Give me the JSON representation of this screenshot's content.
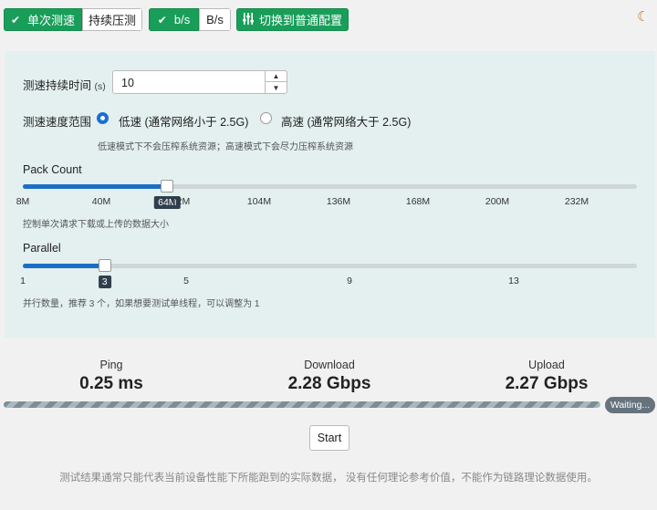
{
  "toolbar": {
    "mode_single": "单次测速",
    "mode_continuous": "持续压测",
    "unit_bits": "b/s",
    "unit_bytes": "B/s",
    "switch_label": "切换到普通配置"
  },
  "settings": {
    "duration_label": "测速持续时间",
    "duration_unit": "(s)",
    "duration_value": "10",
    "range_label": "测速速度范围",
    "low_speed": "低速 (通常网络小于 2.5G)",
    "high_speed": "高速 (通常网络大于 2.5G)",
    "range_note": "低速模式下不会压榨系统资源；高速模式下会尽力压榨系统资源",
    "pack_count_label": "Pack Count",
    "pack_count_value_label": "64M",
    "pack_count_fraction": 0.2353,
    "pack_count_ticks": [
      "8M",
      "40M",
      "72M",
      "104M",
      "136M",
      "168M",
      "200M",
      "232M"
    ],
    "pack_count_note": "控制单次请求下载或上传的数据大小",
    "parallel_label": "Parallel",
    "parallel_value_label": "3",
    "parallel_fraction": 0.1333,
    "parallel_ticks": [
      "1",
      "5",
      "9",
      "13"
    ],
    "parallel_note": "并行数量，推荐 3 个，如果想要测试单线程，可以调整为 1"
  },
  "stats": {
    "ping_label": "Ping",
    "ping_value": "0.25 ms",
    "download_label": "Download",
    "download_value": "2.28 Gbps",
    "upload_label": "Upload",
    "upload_value": "2.27 Gbps"
  },
  "status": {
    "waiting": "Waiting...",
    "start": "Start"
  },
  "footnote": "测试结果通常只能代表当前设备性能下所能跑到的实际数据， 没有任何理论参考价值，不能作为链路理论数据使用。",
  "colors": {
    "accent_green": "#199e5a",
    "slider_blue": "#1a6fc4",
    "panel_bg": "#e3f0ef"
  }
}
